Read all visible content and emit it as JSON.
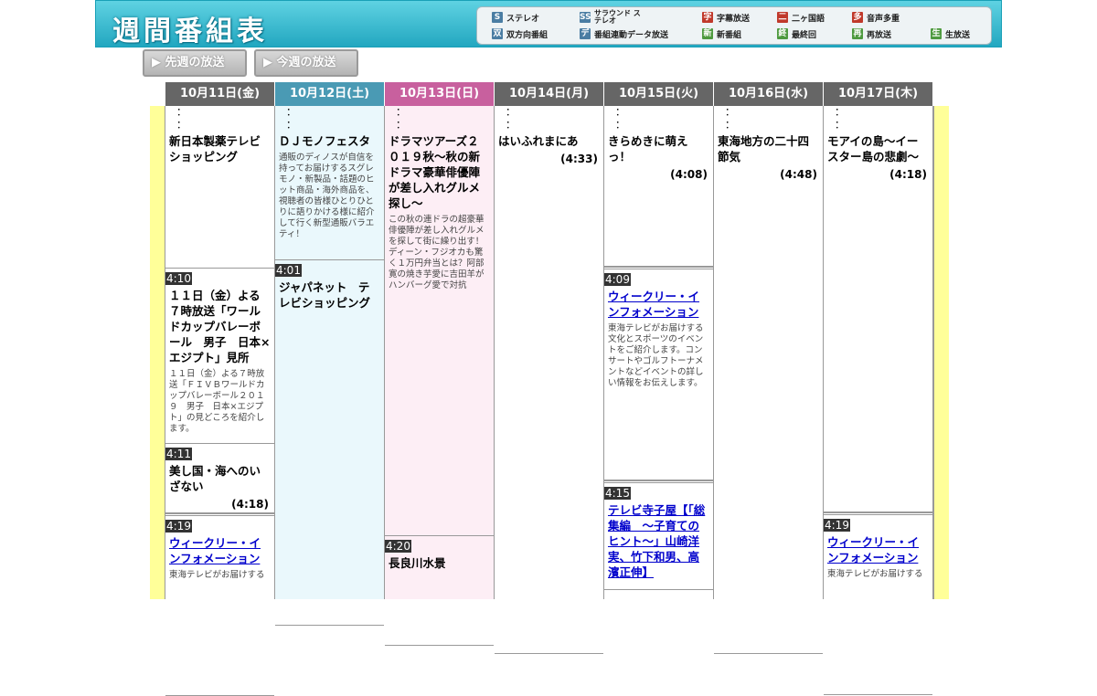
{
  "header": {
    "title": "週間番組表"
  },
  "legend": [
    {
      "icon": "S",
      "label": "ステレオ",
      "color": "#4a7da3"
    },
    {
      "icon": "SS",
      "label": "サラウンド ステレオ",
      "color": "#4a7da3"
    },
    {
      "icon": "字",
      "label": "字幕放送",
      "color": "#c0392b"
    },
    {
      "icon": "二",
      "label": "二ヶ国語",
      "color": "#c0392b"
    },
    {
      "icon": "多",
      "label": "音声多重",
      "color": "#c0392b"
    },
    {
      "icon": "双",
      "label": "双方向番組",
      "color": "#4a7da3"
    },
    {
      "icon": "デ",
      "label": "番組連動データ放送",
      "color": "#4a7da3"
    },
    {
      "icon": "新",
      "label": "新番組",
      "color": "#4e9a3f"
    },
    {
      "icon": "終",
      "label": "最終回",
      "color": "#4e9a3f"
    },
    {
      "icon": "再",
      "label": "再放送",
      "color": "#4e9a3f"
    },
    {
      "icon": "生",
      "label": "生放送",
      "color": "#4e9a3f"
    }
  ],
  "nav": {
    "prev_week": "▶ 先週の放送",
    "this_week": "▶ 今週の放送"
  },
  "colors": {
    "default_head": "#666666",
    "saturday_head": "#4a9ab4",
    "sunday_head": "#c8609e",
    "saturday_bg": "#eaf8fc",
    "sunday_bg": "#fdeef5",
    "side_bar": "#ffff99",
    "link": "#0000cc"
  },
  "days": [
    {
      "label": "10月11日(金)",
      "kind": "weekday",
      "programs": [
        {
          "time": "",
          "continued": true,
          "title": "新日本製薬テレビショッピング",
          "desc": "",
          "duration": "",
          "link": false
        },
        {
          "time": "4:10",
          "continued": false,
          "title": "１１日（金）よる７時放送「ワールドカップバレーボール　男子　日本×エジプト」見所",
          "desc": "１１日（金）よる７時放送「ＦＩＶＢワールドカップバレーボール２０１９　男子　日本×エジプト」の見どころを紹介します。",
          "duration": "",
          "link": false
        },
        {
          "time": "4:11",
          "continued": false,
          "title": "美し国・海へのいざない",
          "desc": "",
          "duration": "(4:18)",
          "link": false
        },
        {
          "time": "4:19",
          "continued": false,
          "title": "ウィークリー・インフォメーション",
          "desc": "東海テレビがお届けする",
          "duration": "",
          "link": true
        }
      ]
    },
    {
      "label": "10月12日(土)",
      "kind": "saturday",
      "programs": [
        {
          "time": "",
          "continued": true,
          "title": "ＤＪモノフェスタ",
          "desc": "通販のディノスが自信を持ってお届けするスグレモノ・新製品・話題のヒット商品・海外商品を、視聴者の皆様ひとりひとりに語りかける様に紹介して行く新型通販バラエティ！",
          "duration": "",
          "link": false
        },
        {
          "time": "4:01",
          "continued": false,
          "title": "ジャパネット　テレビショッピング",
          "desc": "",
          "duration": "",
          "link": false
        }
      ]
    },
    {
      "label": "10月13日(日)",
      "kind": "sunday",
      "programs": [
        {
          "time": "",
          "continued": true,
          "title": "ドラマツアーズ２０１９秋～秋の新ドラマ豪華俳優陣が差し入れグルメ探し～",
          "desc": "この秋の連ドラの超豪華俳優陣が差し入れグルメを探して街に繰り出す！ディーン・フジオカも驚く１万円弁当とは？阿部寛の焼き芋愛に吉田羊がハンバーグ愛で対抗",
          "duration": "",
          "link": false
        },
        {
          "time": "4:20",
          "continued": false,
          "title": "長良川水景",
          "desc": "",
          "duration": "",
          "link": false
        }
      ]
    },
    {
      "label": "10月14日(月)",
      "kind": "weekday",
      "programs": [
        {
          "time": "",
          "continued": true,
          "title": "はいふれまにあ",
          "desc": "",
          "duration": "(4:33)",
          "link": false
        }
      ]
    },
    {
      "label": "10月15日(火)",
      "kind": "weekday",
      "programs": [
        {
          "time": "",
          "continued": true,
          "title": "きらめきに萌えっ！",
          "desc": "",
          "duration": "(4:08)",
          "link": false
        },
        {
          "time": "4:09",
          "continued": false,
          "title": "ウィークリー・インフォメーション",
          "desc": "東海テレビがお届けする文化とスポーツのイベントをご紹介します。コンサートやゴルフトーナメントなどイベントの詳しい情報をお伝えします。",
          "duration": "",
          "link": true
        },
        {
          "time": "4:15",
          "continued": false,
          "title": "テレビ寺子屋【「総集編　～子育てのヒント～」山崎洋実、竹下和男、高濱正伸】",
          "desc": "",
          "duration": "",
          "link": true
        }
      ]
    },
    {
      "label": "10月16日(水)",
      "kind": "weekday",
      "programs": [
        {
          "time": "",
          "continued": true,
          "title": "東海地方の二十四節気",
          "desc": "",
          "duration": "(4:48)",
          "link": false
        }
      ]
    },
    {
      "label": "10月17日(木)",
      "kind": "weekday",
      "programs": [
        {
          "time": "",
          "continued": true,
          "title": "モアイの島～イースター島の悲劇～",
          "desc": "",
          "duration": "(4:18)",
          "link": false
        },
        {
          "time": "4:19",
          "continued": false,
          "title": "ウィークリー・インフォメーション",
          "desc": "東海テレビがお届けする",
          "duration": "",
          "link": true
        }
      ]
    }
  ]
}
